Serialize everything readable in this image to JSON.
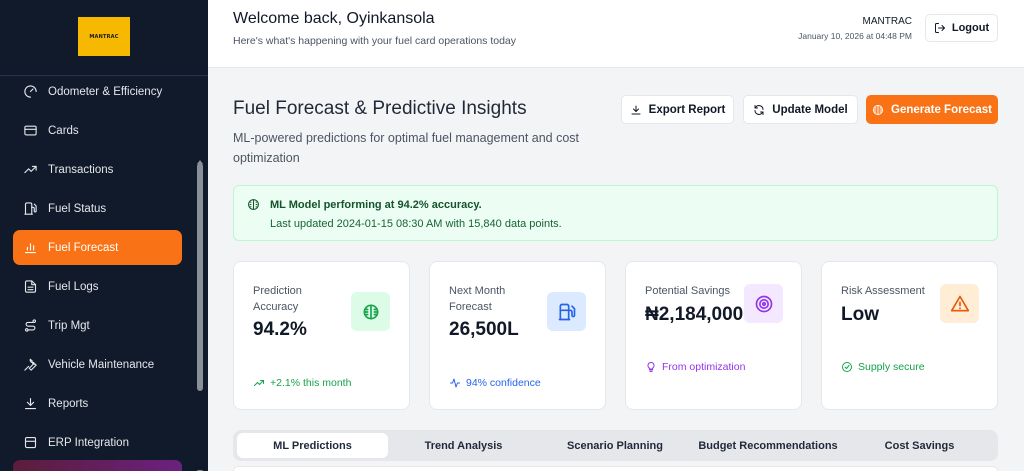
{
  "sidebar": {
    "logo_text": "MANTRAC",
    "items": [
      {
        "label": "Odometer & Efficiency",
        "icon": "gauge-icon"
      },
      {
        "label": "Cards",
        "icon": "credit-card-icon"
      },
      {
        "label": "Transactions",
        "icon": "trending-up-icon"
      },
      {
        "label": "Fuel Status",
        "icon": "fuel-pump-icon"
      },
      {
        "label": "Fuel Forecast",
        "icon": "bar-chart-icon",
        "active": true
      },
      {
        "label": "Fuel Logs",
        "icon": "file-text-icon"
      },
      {
        "label": "Trip Mgt",
        "icon": "route-icon"
      },
      {
        "label": "Vehicle Maintenance",
        "icon": "wrench-icon"
      },
      {
        "label": "Reports",
        "icon": "download-icon"
      },
      {
        "label": "ERP Integration",
        "icon": "database-icon"
      }
    ]
  },
  "header": {
    "welcome": "Welcome back, Oyinkansola",
    "subtitle": "Here's what's happening with your fuel card operations today",
    "company": "MANTRAC",
    "datetime": "January 10, 2026 at 04:48 PM",
    "logout_label": "Logout"
  },
  "page": {
    "title": "Fuel Forecast & Predictive Insights",
    "description": "ML-powered predictions for optimal fuel management and cost optimization",
    "buttons": {
      "export": "Export Report",
      "update": "Update Model",
      "generate": "Generate Forecast"
    }
  },
  "alert": {
    "title": "ML Model performing at 94.2% accuracy.",
    "text": "Last updated 2024-01-15 08:30 AM with 15,840 data points."
  },
  "cards": [
    {
      "label": "Prediction Accuracy",
      "value": "94.2%",
      "footer": "+2.1% this month",
      "icon": "brain-icon"
    },
    {
      "label": "Next Month Forecast",
      "value": "26,500L",
      "footer": "94% confidence",
      "icon": "fuel-icon"
    },
    {
      "label": "Potential Savings",
      "value": "₦2,184,000",
      "footer": "From optimization",
      "icon": "target-icon"
    },
    {
      "label": "Risk Assessment",
      "value": "Low",
      "footer": "Supply secure",
      "icon": "alert-triangle-icon"
    }
  ],
  "tabs": [
    "ML Predictions",
    "Trend Analysis",
    "Scenario Planning",
    "Budget Recommendations",
    "Cost Savings"
  ],
  "colors": {
    "sidebar_bg": "#111a2b",
    "accent": "#f97316",
    "success": "#16a34a",
    "info": "#2563eb",
    "purple": "#9333ea",
    "warning": "#ea580c"
  }
}
